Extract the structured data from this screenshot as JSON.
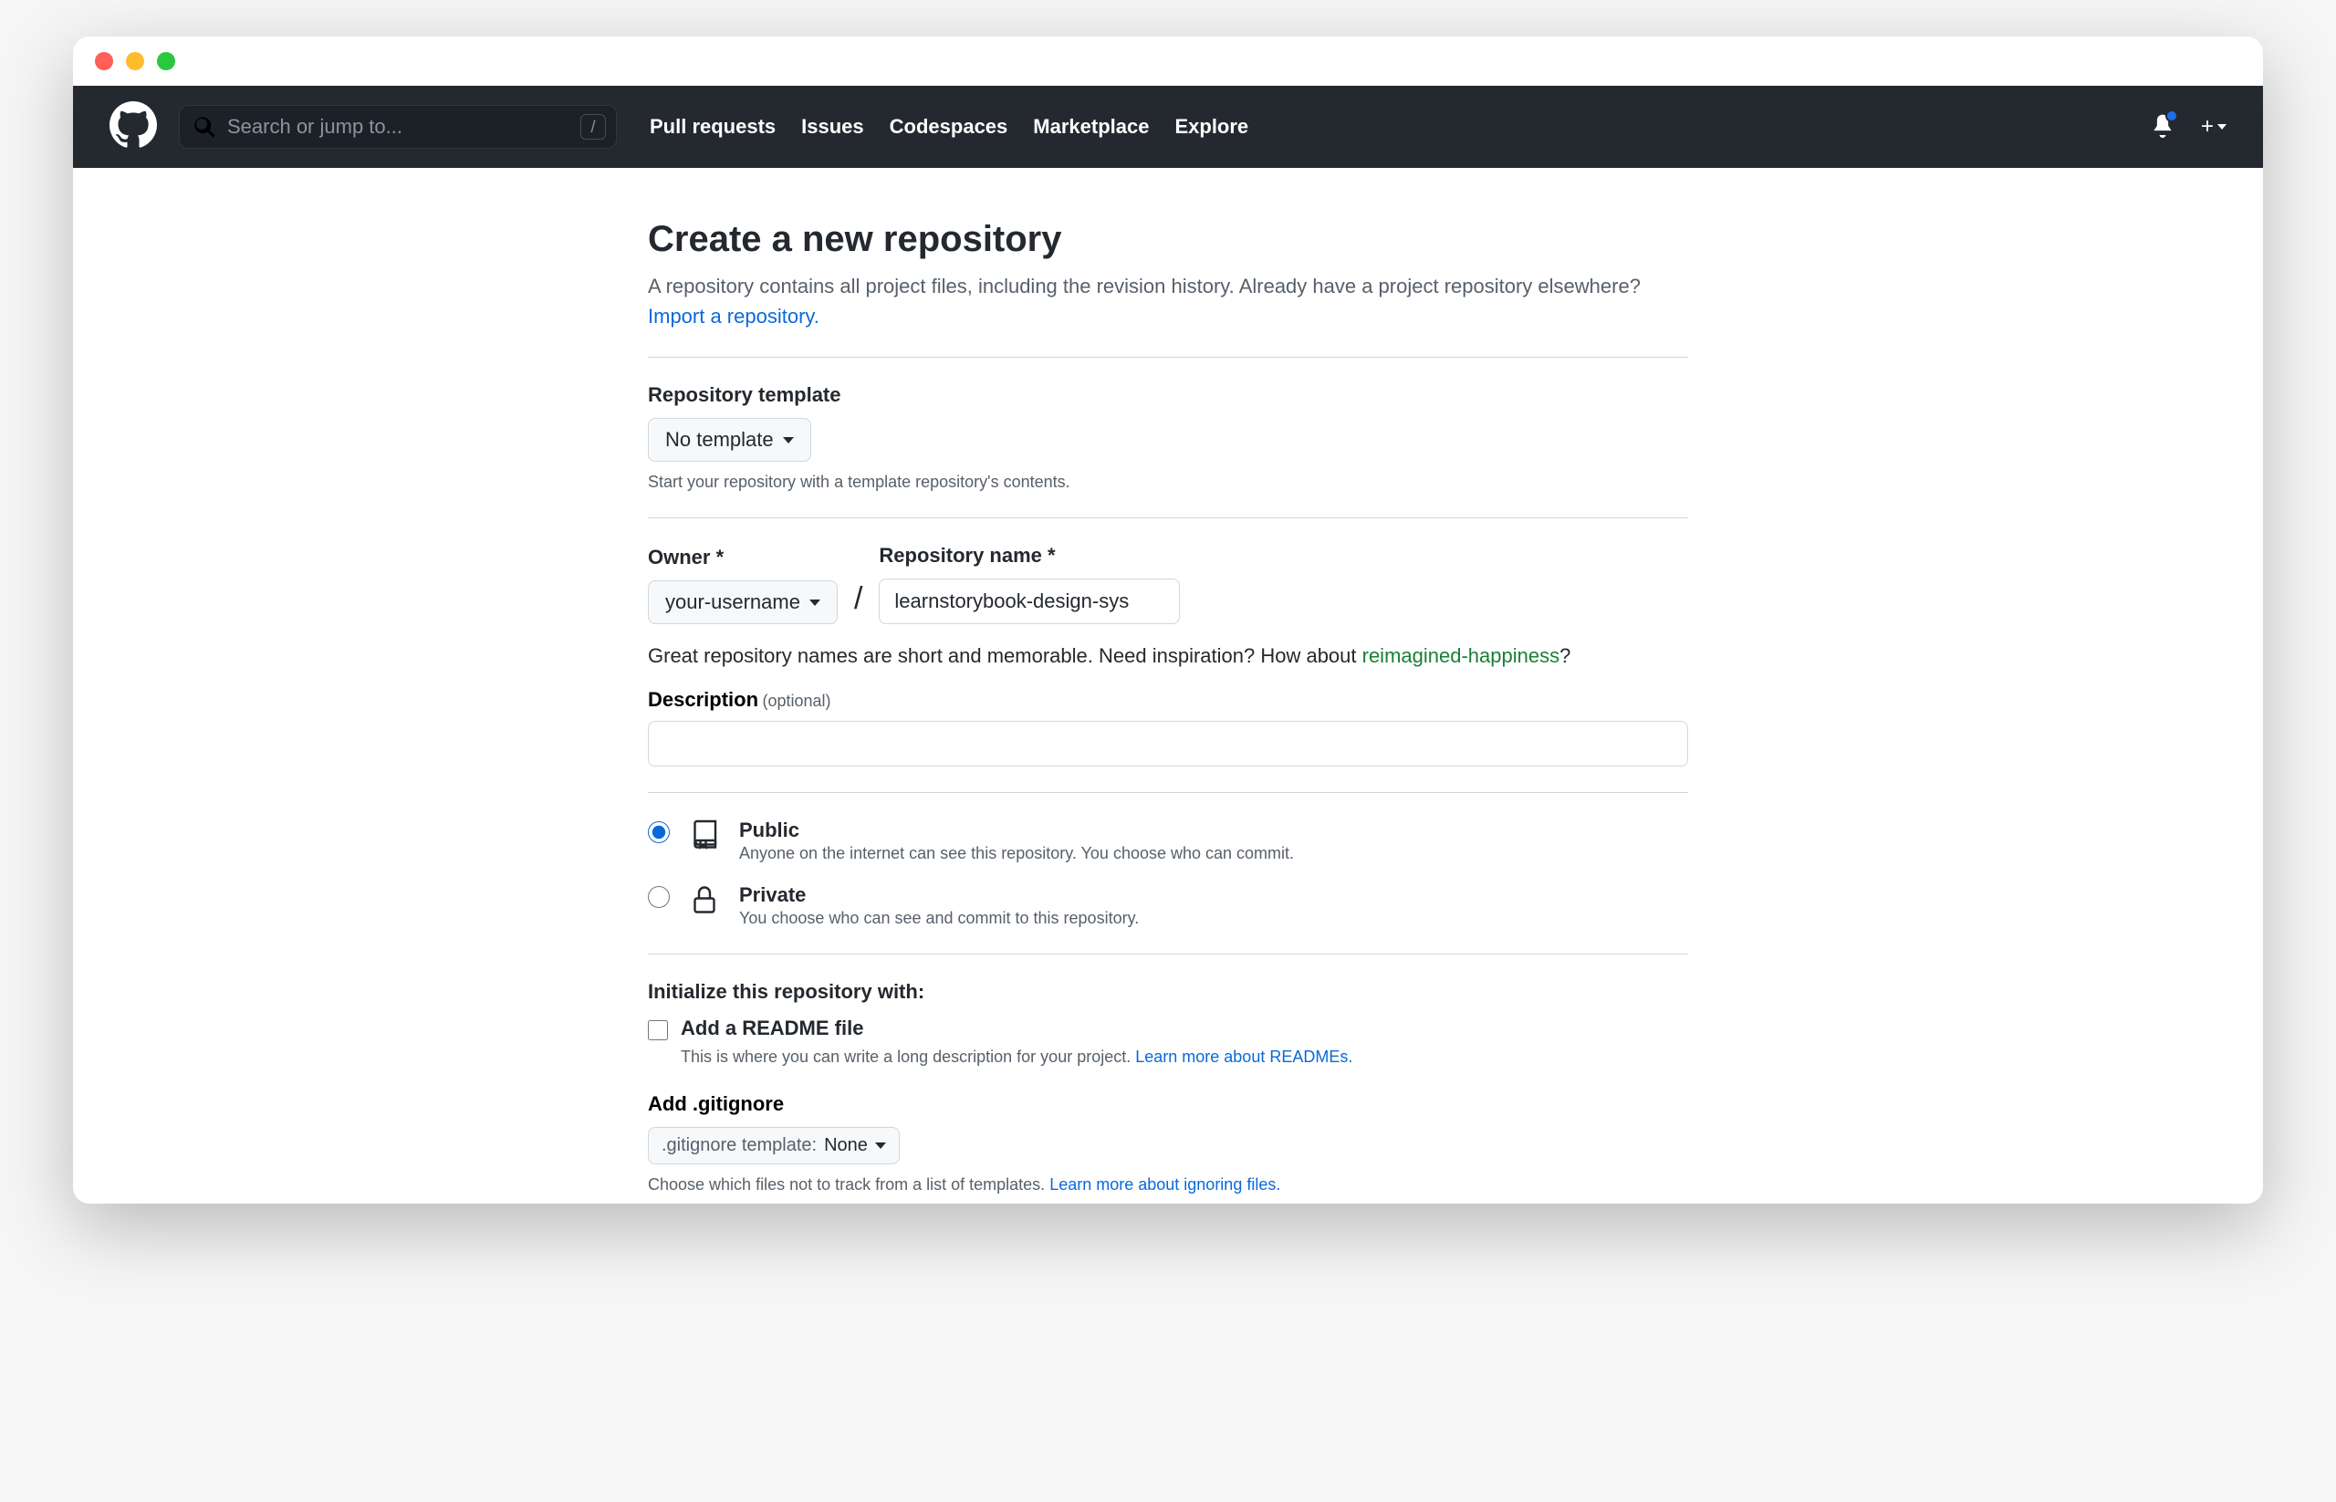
{
  "header": {
    "search_placeholder": "Search or jump to...",
    "slash_key": "/",
    "nav": [
      "Pull requests",
      "Issues",
      "Codespaces",
      "Marketplace",
      "Explore"
    ]
  },
  "page": {
    "title": "Create a new repository",
    "subtitle_a": "A repository contains all project files, including the revision history. Already have a project repository elsewhere? ",
    "subtitle_link": "Import a repository."
  },
  "template": {
    "label": "Repository template",
    "value": "No template",
    "note": "Start your repository with a template repository's contents."
  },
  "owner": {
    "label": "Owner *",
    "value": "your-username"
  },
  "repo": {
    "label": "Repository name *",
    "value": "learnstorybook-design-sys"
  },
  "hint": {
    "text_a": "Great repository names are short and memorable. Need inspiration? How about ",
    "suggestion": "reimagined-happiness",
    "q": "?"
  },
  "description": {
    "label": "Description",
    "optional": "(optional)",
    "value": ""
  },
  "visibility": {
    "public": {
      "title": "Public",
      "desc": "Anyone on the internet can see this repository. You choose who can commit."
    },
    "private": {
      "title": "Private",
      "desc": "You choose who can see and commit to this repository."
    }
  },
  "init": {
    "title": "Initialize this repository with:",
    "readme": {
      "label": "Add a README file",
      "desc": "This is where you can write a long description for your project. ",
      "link": "Learn more about READMEs."
    }
  },
  "gitignore": {
    "label": "Add .gitignore",
    "prefix": ".gitignore template: ",
    "value": "None",
    "note": "Choose which files not to track from a list of templates. ",
    "link": "Learn more about ignoring files."
  }
}
